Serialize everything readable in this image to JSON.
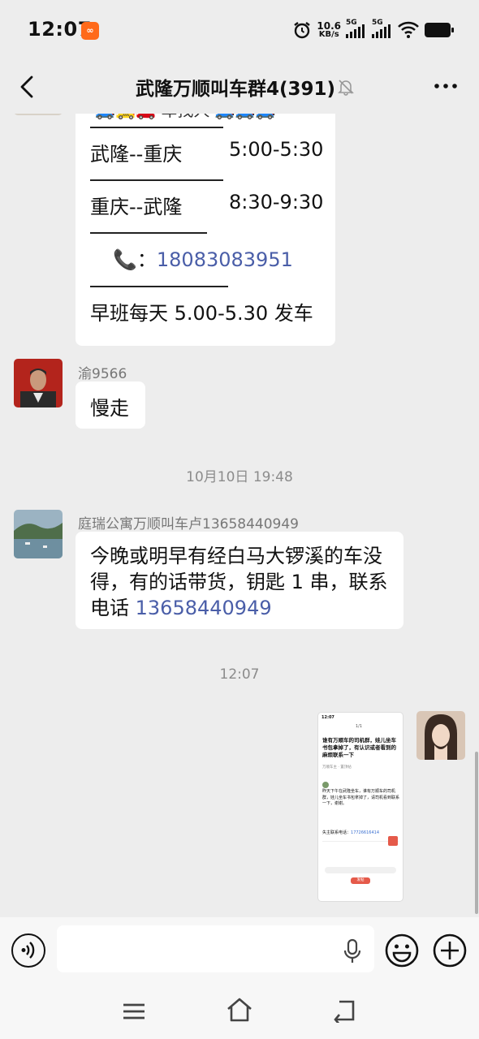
{
  "status_bar": {
    "time": "12:07",
    "net_speed": "10.6",
    "net_unit": "KB/s",
    "sim1": "5G",
    "sim2": "5G"
  },
  "header": {
    "title": "武隆万顺叫车群4(391)"
  },
  "messages": {
    "schedule": {
      "emoji_line": "·🚙🚕🚗 车找人 🚙🚙🚙",
      "route1": "武隆--重庆",
      "time1": "5:00-5:30",
      "route2": "重庆--武隆",
      "time2": "8:30-9:30",
      "phone_icon": "📞",
      "phone_colon": "：",
      "phone": "18083083951",
      "note": "早班每天 5.00-5.30 发车"
    },
    "msg2": {
      "sender": "渝9566",
      "text": "慢走"
    },
    "timestamp1": "10月10日 19:48",
    "msg3": {
      "sender": "庭瑞公寓万顺叫车卢13658440949",
      "text_line1": "今晚或明早有经白马大锣溪的车没",
      "text_line2": "得，有的话带货，钥匙 1 串，联系",
      "text_line3_prefix": "电话 ",
      "phone": "13658440949"
    },
    "timestamp2": "12:07",
    "image_msg": {
      "thumb_time": "12:07",
      "thumb_page": "1/1",
      "thumb_title": "谁有万顺车的司机群，娃儿坐车书包拿掉了，有认识或者看到的麻烦联系一下",
      "thumb_meta": "万顺车主 · 置顶帖",
      "thumb_body": "昨天下午在武隆坐车，谁有万顺车的司机群，娃儿坐车书包拿掉了，请司机看到联系一下，谢谢。",
      "thumb_phone_label": "失主联系电话：",
      "thumb_phone": "17726616414",
      "thumb_button": "发帖"
    }
  },
  "colors": {
    "background": "#ededed",
    "bubble": "#ffffff",
    "link": "#4a5ea8",
    "timestamp": "#8c8c8c"
  }
}
